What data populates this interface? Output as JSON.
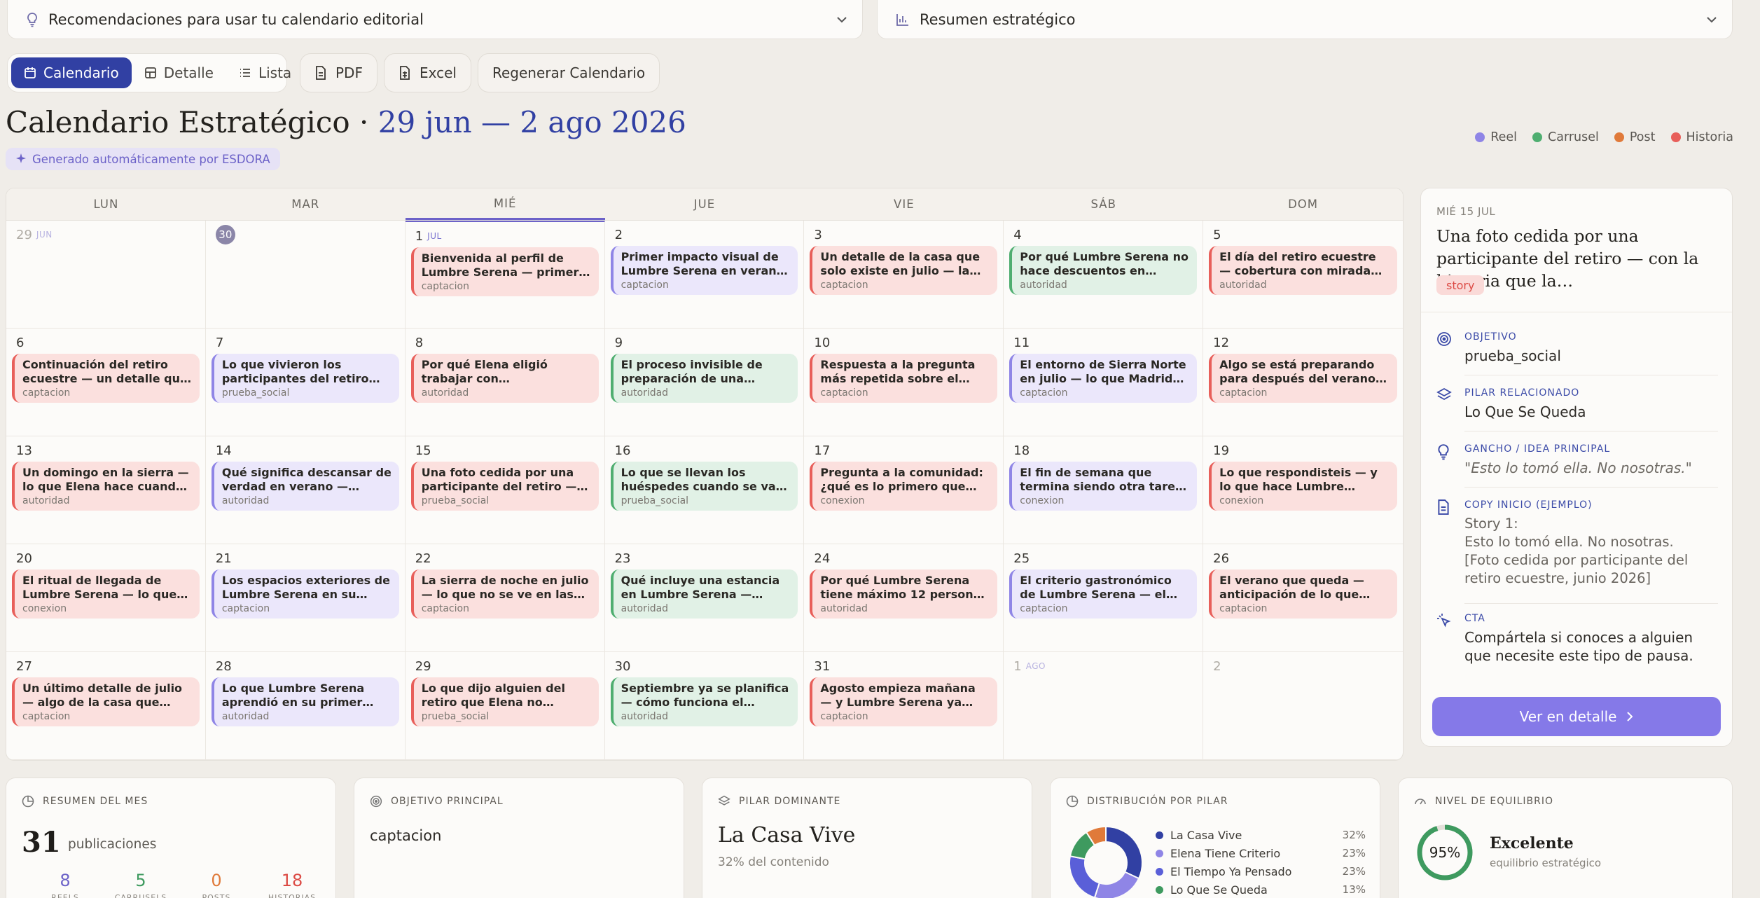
{
  "top_dropdowns": {
    "recommendations": "Recomendaciones para usar tu calendario editorial",
    "summary": "Resumen estratégico"
  },
  "toolbar": {
    "views": [
      "Calendario",
      "Detalle",
      "Lista"
    ],
    "pdf": "PDF",
    "excel": "Excel",
    "regenerate": "Regenerar Calendario"
  },
  "header": {
    "title": "Calendario Estratégico ·",
    "dates": "29 jun — 2 ago 2026",
    "generated_badge": "Generado automáticamente por ESDORA"
  },
  "legend": [
    {
      "label": "Reel",
      "color": "#8f85e6"
    },
    {
      "label": "Carrusel",
      "color": "#4fae70"
    },
    {
      "label": "Post",
      "color": "#e07a3a"
    },
    {
      "label": "Historia",
      "color": "#e85f5a"
    }
  ],
  "calendar": {
    "weekdays": [
      "LUN",
      "MAR",
      "MIÉ",
      "JUE",
      "VIE",
      "SÁB",
      "DOM"
    ],
    "today_index": 2,
    "days": [
      {
        "n": "29",
        "mon": "JUN",
        "muted": true
      },
      {
        "n": "30",
        "circle": true
      },
      {
        "n": "1",
        "mon": "JUL",
        "today": true,
        "post": {
          "t": "Bienvenida al perfil de Lumbre Serena — primer día en redes",
          "g": "captacion",
          "c": "red"
        }
      },
      {
        "n": "2",
        "post": {
          "t": "Primer impacto visual de Lumbre Serena en verano — la casa en…",
          "g": "captacion",
          "c": "purple"
        }
      },
      {
        "n": "3",
        "post": {
          "t": "Un detalle de la casa que solo existe en julio — la luz, el jardín, …",
          "g": "captacion",
          "c": "red"
        }
      },
      {
        "n": "4",
        "post": {
          "t": "Por qué Lumbre Serena no hace descuentos en temporada alta …",
          "g": "autoridad",
          "c": "green"
        }
      },
      {
        "n": "5",
        "post": {
          "t": "El día del retiro ecuestre — cobertura con mirada editorial…",
          "g": "autoridad",
          "c": "red"
        }
      },
      {
        "n": "6",
        "post": {
          "t": "Continuación del retiro ecuestre — un detalle que no salió en el…",
          "g": "captacion",
          "c": "red"
        }
      },
      {
        "n": "7",
        "post": {
          "t": "Lo que vivieron los participantes del retiro ecuestre — desde la…",
          "g": "prueba_social",
          "c": "purple"
        }
      },
      {
        "n": "8",
        "post": {
          "t": "Por qué Elena eligió trabajar con @tamimeditación — criterio de…",
          "g": "autoridad",
          "c": "red"
        }
      },
      {
        "n": "9",
        "post": {
          "t": "El proceso invisible de preparación de una estancia en…",
          "g": "autoridad",
          "c": "green"
        }
      },
      {
        "n": "10",
        "post": {
          "t": "Respuesta a la pregunta más repetida sobre el retiro — lo qu…",
          "g": "captacion",
          "c": "red"
        }
      },
      {
        "n": "11",
        "post": {
          "t": "El entorno de Sierra Norte en julio — lo que Madrid no tiene a…",
          "g": "captacion",
          "c": "purple"
        }
      },
      {
        "n": "12",
        "post": {
          "t": "Algo se está preparando para después del verano — primera…",
          "g": "captacion",
          "c": "red"
        }
      },
      {
        "n": "13",
        "post": {
          "t": "Un domingo en la sierra — lo que Elena hace cuando no hay…",
          "g": "autoridad",
          "c": "red"
        }
      },
      {
        "n": "14",
        "post": {
          "t": "Qué significa descansar de verdad en verano — posición de…",
          "g": "autoridad",
          "c": "purple"
        }
      },
      {
        "n": "15",
        "post": {
          "t": "Una foto cedida por una participante del retiro — con la…",
          "g": "prueba_social",
          "c": "red"
        }
      },
      {
        "n": "16",
        "post": {
          "t": "Lo que se llevan los huéspedes cuando se van — testimonios…",
          "g": "prueba_social",
          "c": "green"
        }
      },
      {
        "n": "17",
        "post": {
          "t": "Pregunta a la comunidad: ¿qué es lo primero que haces cuando…",
          "g": "conexion",
          "c": "red"
        }
      },
      {
        "n": "18",
        "post": {
          "t": "El fin de semana que termina siendo otra tarea —…",
          "g": "conexion",
          "c": "purple"
        }
      },
      {
        "n": "19",
        "post": {
          "t": "Lo que respondisteis — y lo que hace Lumbre Serena con esa…",
          "g": "conexion",
          "c": "red"
        }
      },
      {
        "n": "20",
        "post": {
          "t": "El ritual de llegada de Lumbre Serena — lo que Elena prepara…",
          "g": "conexion",
          "c": "red"
        }
      },
      {
        "n": "21",
        "post": {
          "t": "Los espacios exteriores de Lumbre Serena en su momento…",
          "g": "captacion",
          "c": "purple"
        }
      },
      {
        "n": "22",
        "post": {
          "t": "La sierra de noche en julio — lo que no se ve en las fotos de día",
          "g": "captacion",
          "c": "red"
        }
      },
      {
        "n": "23",
        "post": {
          "t": "Qué incluye una estancia en Lumbre Serena — transparenci…",
          "g": "autoridad",
          "c": "green"
        }
      },
      {
        "n": "24",
        "post": {
          "t": "Por qué Lumbre Serena tiene máximo 12 personas — el…",
          "g": "autoridad",
          "c": "red"
        }
      },
      {
        "n": "25",
        "post": {
          "t": "El criterio gastronómico de Lumbre Serena — el buffet…",
          "g": "captacion",
          "c": "purple"
        }
      },
      {
        "n": "26",
        "post": {
          "t": "El verano que queda — anticipación de lo que Lumbre…",
          "g": "captacion",
          "c": "red"
        }
      },
      {
        "n": "27",
        "post": {
          "t": "Un último detalle de julio — algo de la casa que cambia en agosto",
          "g": "captacion",
          "c": "red"
        }
      },
      {
        "n": "28",
        "post": {
          "t": "Lo que Lumbre Serena aprendió en su primer mes en redes —…",
          "g": "autoridad",
          "c": "purple"
        }
      },
      {
        "n": "29",
        "post": {
          "t": "Lo que dijo alguien del retiro que Elena no olvidará — testimonio…",
          "g": "prueba_social",
          "c": "red"
        }
      },
      {
        "n": "30",
        "post": {
          "t": "Septiembre ya se planifica — cómo funciona el proceso de…",
          "g": "autoridad",
          "c": "green"
        }
      },
      {
        "n": "31",
        "post": {
          "t": "Agosto empieza mañana — y Lumbre Serena ya piensa en…",
          "g": "captacion",
          "c": "red"
        }
      },
      {
        "n": "1",
        "mon": "AGO",
        "muted": true
      },
      {
        "n": "2",
        "muted": true
      }
    ]
  },
  "detail": {
    "date": "MIÉ 15 JUL",
    "title": "Una foto cedida por una participante del retiro — con la historia que la…",
    "tag": "story",
    "objective_label": "OBJETIVO",
    "objective": "prueba_social",
    "pillar_label": "PILAR RELACIONADO",
    "pillar": "Lo Que Se Queda",
    "hook_label": "GANCHO / IDEA PRINCIPAL",
    "hook": "\"Esto lo tomó ella. No nosotras.\"",
    "copy_label": "COPY INICIO (EJEMPLO)",
    "copy": [
      "Story 1:",
      "Esto lo tomó ella. No nosotras.",
      "[Foto cedida por participante del retiro ecuestre, junio 2026]"
    ],
    "cta_label": "CTA",
    "cta": "Compártela si conoces a alguien que necesite este tipo de pausa.",
    "button": "Ver en detalle"
  },
  "summary_cards": {
    "month": {
      "label": "RESUMEN DEL MES",
      "total": "31",
      "total_label": "publicaciones",
      "stats": [
        {
          "n": "8",
          "l": "REELS",
          "color": "#6c62c8"
        },
        {
          "n": "5",
          "l": "CARRUSELS",
          "color": "#3e9a5f"
        },
        {
          "n": "0",
          "l": "POSTS",
          "color": "#e07a3a"
        },
        {
          "n": "18",
          "l": "HISTORIAS",
          "color": "#dc4b45"
        }
      ]
    },
    "objective": {
      "label": "OBJETIVO PRINCIPAL",
      "value": "captacion"
    },
    "pillar": {
      "label": "PILAR DOMINANTE",
      "value": "La Casa Vive",
      "sub": "32% del contenido"
    },
    "distribution": {
      "label": "DISTRIBUCIÓN POR PILAR",
      "items": [
        {
          "name": "La Casa Vive",
          "pct": "32%",
          "value": 32,
          "color": "#3140a3"
        },
        {
          "name": "Elena Tiene Criterio",
          "pct": "23%",
          "value": 23,
          "color": "#8f85e6"
        },
        {
          "name": "El Tiempo Ya Pensado",
          "pct": "23%",
          "value": 23,
          "color": "#5a5fd8"
        },
        {
          "name": "Lo Que Se Queda",
          "pct": "13%",
          "value": 13,
          "color": "#3e9a5f"
        },
        {
          "name": "",
          "pct": "",
          "value": 9,
          "color": "#e07a3a"
        }
      ]
    },
    "balance": {
      "label": "NIVEL DE EQUILIBRIO",
      "pct": "95%",
      "value": 95,
      "status": "Excelente",
      "sub": "equilibrio estratégico"
    }
  }
}
